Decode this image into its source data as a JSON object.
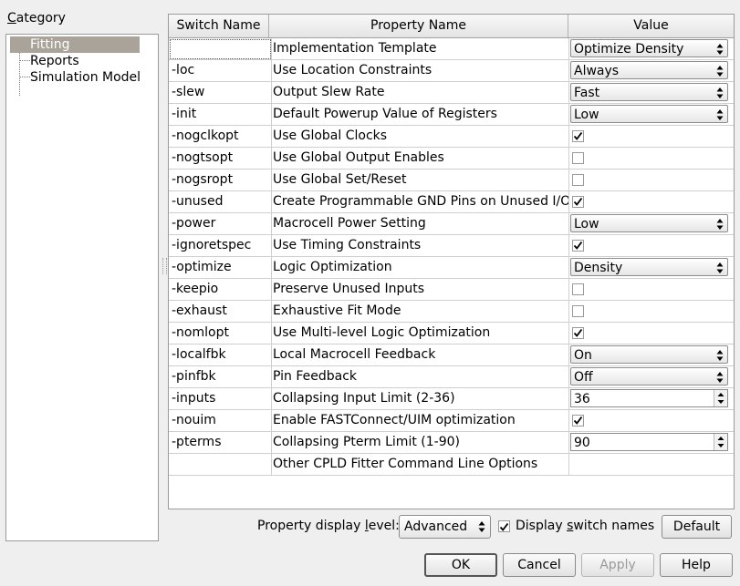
{
  "category": {
    "label_prefix": "C",
    "label_rest": "ategory",
    "items": [
      "Fitting",
      "Reports",
      "Simulation Model"
    ],
    "selected": "Fitting"
  },
  "grid": {
    "headers": [
      "Switch Name",
      "Property Name",
      "Value"
    ],
    "rows": [
      {
        "switch": "",
        "property": "Implementation Template",
        "type": "combo",
        "value": "Optimize Density"
      },
      {
        "switch": "-loc",
        "property": "Use Location Constraints",
        "type": "combo",
        "value": "Always"
      },
      {
        "switch": "-slew",
        "property": "Output Slew Rate",
        "type": "combo",
        "value": "Fast"
      },
      {
        "switch": "-init",
        "property": "Default Powerup Value of Registers",
        "type": "combo",
        "value": "Low"
      },
      {
        "switch": "-nogclkopt",
        "property": "Use Global Clocks",
        "type": "check",
        "value": "true"
      },
      {
        "switch": "-nogtsopt",
        "property": "Use Global Output Enables",
        "type": "check",
        "value": "false"
      },
      {
        "switch": "-nogsropt",
        "property": "Use Global Set/Reset",
        "type": "check",
        "value": "false"
      },
      {
        "switch": "-unused",
        "property": "Create Programmable GND Pins on Unused I/O",
        "type": "check",
        "value": "true"
      },
      {
        "switch": "-power",
        "property": "Macrocell Power Setting",
        "type": "combo",
        "value": "Low"
      },
      {
        "switch": "-ignoretspec",
        "property": "Use Timing Constraints",
        "type": "check",
        "value": "true"
      },
      {
        "switch": "-optimize",
        "property": "Logic Optimization",
        "type": "combo",
        "value": "Density"
      },
      {
        "switch": "-keepio",
        "property": "Preserve Unused Inputs",
        "type": "check",
        "value": "false"
      },
      {
        "switch": "-exhaust",
        "property": "Exhaustive Fit Mode",
        "type": "check",
        "value": "false"
      },
      {
        "switch": "-nomlopt",
        "property": "Use Multi-level Logic Optimization",
        "type": "check",
        "value": "true"
      },
      {
        "switch": "-localfbk",
        "property": "Local Macrocell Feedback",
        "type": "combo",
        "value": "On"
      },
      {
        "switch": "-pinfbk",
        "property": "Pin Feedback",
        "type": "combo",
        "value": "Off"
      },
      {
        "switch": "-inputs",
        "property": "Collapsing Input Limit (2-36)",
        "type": "spin",
        "value": "36"
      },
      {
        "switch": "-nouim",
        "property": "Enable FASTConnect/UIM optimization",
        "type": "check",
        "value": "true"
      },
      {
        "switch": "-pterms",
        "property": "Collapsing Pterm Limit (1-90)",
        "type": "spin",
        "value": "90"
      },
      {
        "switch": "",
        "property": "Other CPLD Fitter Command Line Options",
        "type": "text",
        "value": ""
      }
    ]
  },
  "bottom": {
    "display_level_label_a": "Property display ",
    "display_level_label_u": "l",
    "display_level_label_b": "evel:",
    "display_level_value": "Advanced",
    "switch_names_a": "Display ",
    "switch_names_u": "s",
    "switch_names_b": "witch names",
    "switch_names_checked": true,
    "default_label": "Default"
  },
  "buttons": {
    "ok": "OK",
    "cancel": "Cancel",
    "apply": "Apply",
    "help": "Help"
  }
}
